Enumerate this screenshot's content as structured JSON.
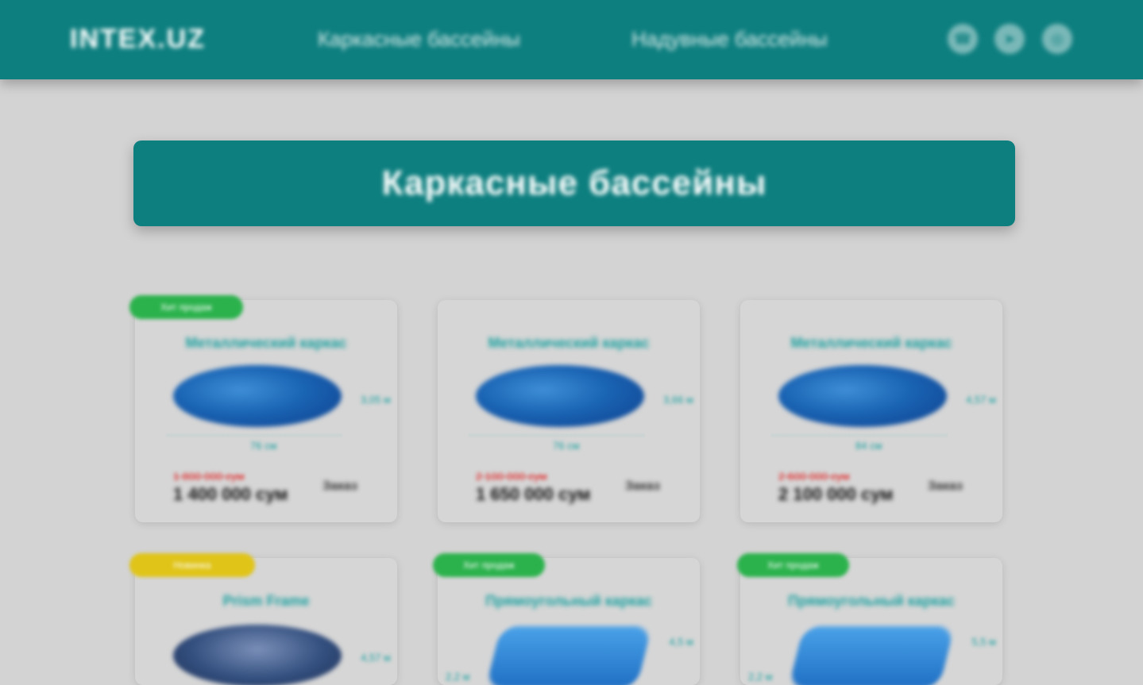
{
  "header": {
    "logo": "INTEX.UZ",
    "nav": [
      "Каркасные бассейны",
      "Надувные бассейны"
    ],
    "icons": [
      "phone-icon",
      "telegram-icon",
      "instagram-icon"
    ]
  },
  "banner": {
    "title": "Каркасные бассейны"
  },
  "products": [
    {
      "badge": "Хит продаж",
      "badge_color": "#2bb24c",
      "title": "Металлический каркас",
      "width": "3,05 м",
      "depth": "76 см",
      "old_price": "1 800 000 сум",
      "price": "1 400 000 сум",
      "cta": "Заказ"
    },
    {
      "badge": "",
      "badge_color": "",
      "title": "Металлический каркас",
      "width": "3,66 м",
      "depth": "76 см",
      "old_price": "2 100 000 сум",
      "price": "1 650 000 сум",
      "cta": "Заказ"
    },
    {
      "badge": "",
      "badge_color": "",
      "title": "Металлический каркас",
      "width": "4,57 м",
      "depth": "84 см",
      "old_price": "2 600 000 сум",
      "price": "2 100 000 сум",
      "cta": "Заказ"
    },
    {
      "badge": "Новинка",
      "badge_color": "#e0c418",
      "title": "Prism Frame",
      "width": "4,57 м",
      "depth": "",
      "old_price": "",
      "price": "",
      "cta": ""
    },
    {
      "badge": "Хит продаж",
      "badge_color": "#2bb24c",
      "title": "Прямоугольный каркас",
      "width": "4,5 м",
      "depth": "2,2 м",
      "old_price": "",
      "price": "",
      "cta": ""
    },
    {
      "badge": "Хит продаж",
      "badge_color": "#2bb24c",
      "title": "Прямоугольный каркас",
      "width": "5,5 м",
      "depth": "2,2 м",
      "old_price": "",
      "price": "",
      "cta": ""
    }
  ]
}
